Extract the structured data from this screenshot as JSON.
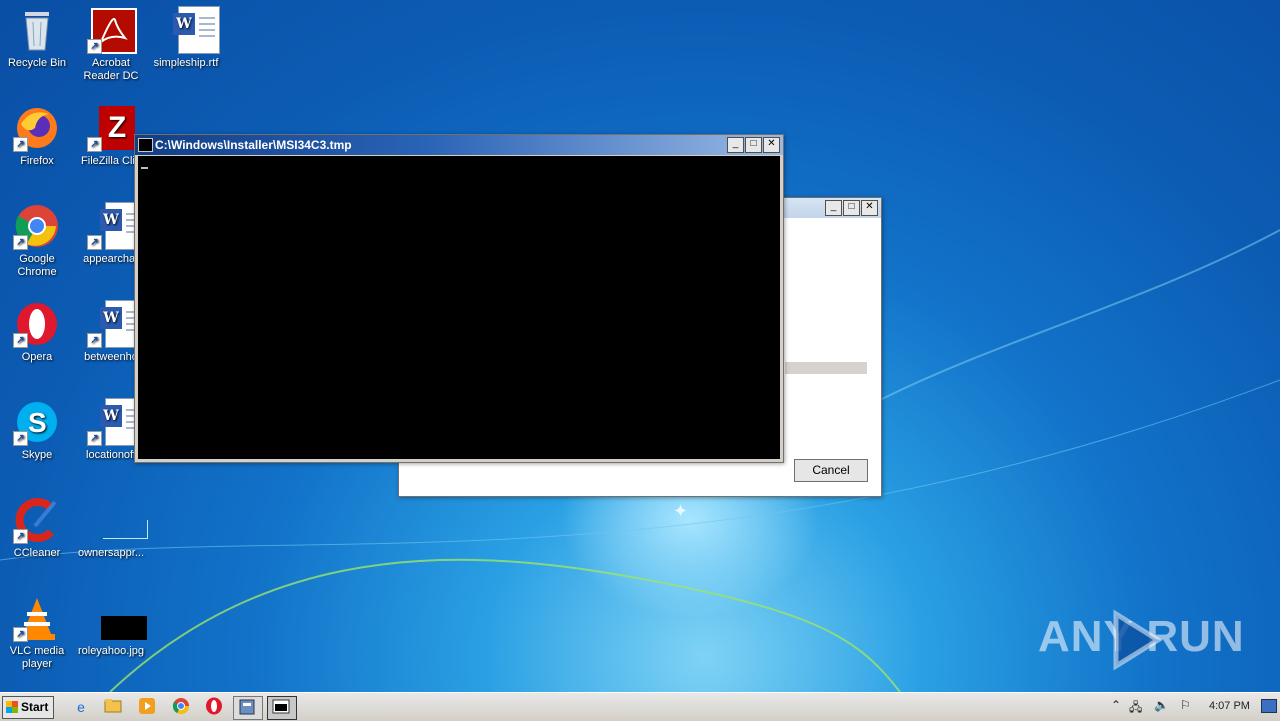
{
  "desktop_icons": [
    {
      "name": "recycle-bin",
      "label": "Recycle Bin"
    },
    {
      "name": "acrobat",
      "label": "Acrobat Reader DC"
    },
    {
      "name": "simpleship",
      "label": "simpleship.rtf"
    },
    {
      "name": "firefox",
      "label": "Firefox"
    },
    {
      "name": "filezilla",
      "label": "FileZilla Clie"
    },
    {
      "name": "chrome",
      "label": "Google Chrome"
    },
    {
      "name": "appearchar",
      "label": "appearchar"
    },
    {
      "name": "opera",
      "label": "Opera"
    },
    {
      "name": "betweenho",
      "label": "betweenho"
    },
    {
      "name": "skype",
      "label": "Skype"
    },
    {
      "name": "locationoff",
      "label": "locationoff"
    },
    {
      "name": "ccleaner",
      "label": "CCleaner"
    },
    {
      "name": "ownersappr",
      "label": "ownersappr..."
    },
    {
      "name": "vlc",
      "label": "VLC media player"
    },
    {
      "name": "roleyahoo",
      "label": "roleyahoo.jpg"
    }
  ],
  "console_window": {
    "title": "C:\\Windows\\Installer\\MSI34C3.tmp"
  },
  "installer_window": {
    "cancel_label": "Cancel"
  },
  "taskbar": {
    "start_label": "Start",
    "clock": "4:07 PM"
  },
  "watermark": "ANY RUN"
}
